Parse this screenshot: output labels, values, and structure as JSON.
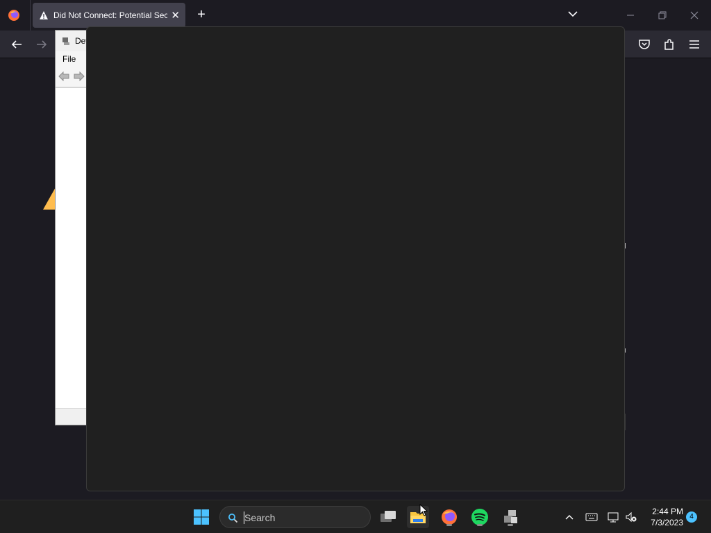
{
  "browser": {
    "tab": {
      "title": "Did Not Connect: Potential Sec",
      "close_glyph": "✕"
    },
    "new_tab_glyph": "+",
    "icons": [
      "firefox-logo-icon",
      "warning-icon",
      "chevron-down-icon",
      "minimize-icon",
      "restore-icon",
      "close-icon",
      "back-arrow-icon",
      "forward-arrow-icon",
      "pocket-icon",
      "extensions-icon",
      "hamburger-menu-icon"
    ]
  },
  "device_manager": {
    "title": "Dev",
    "menu": [
      "File"
    ]
  },
  "taskbar": {
    "search_placeholder": "Search",
    "time": "2:44 PM",
    "date": "7/3/2023",
    "notification_count": "4",
    "icons": [
      "windows-start-icon",
      "search-icon",
      "task-view-icon",
      "file-explorer-icon",
      "firefox-icon",
      "spotify-icon",
      "device-manager-icon",
      "chevron-up-icon",
      "keyboard-icon",
      "network-icon",
      "volume-muted-icon"
    ]
  },
  "colors": {
    "accent_blue": "#4cc2ff",
    "spotify_green": "#1ed760",
    "folder_yellow": "#f8c640",
    "warning_orange": "#ffbd4f"
  }
}
